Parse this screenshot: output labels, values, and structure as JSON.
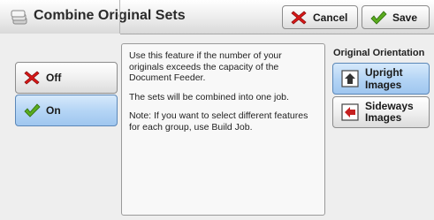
{
  "header": {
    "title": "Combine Original Sets",
    "cancel_label": "Cancel",
    "save_label": "Save",
    "title_icon": "stacked-pages-icon",
    "cancel_icon": "red-x-icon",
    "save_icon": "green-check-icon"
  },
  "options": {
    "off_label": "Off",
    "on_label": "On",
    "selected": "On"
  },
  "message": {
    "line1": "Use this feature if the number of your originals exceeds the capacity of the Document Feeder.",
    "line2": "The sets will be combined into one job.",
    "line3": "Note: If you want to select different features for each group, use Build Job."
  },
  "orientation": {
    "label": "Original Orientation",
    "upright_label": "Upright Images",
    "sideways_label": "Sideways Images",
    "selected": "Upright Images"
  },
  "colors": {
    "selected_blue": "#b5d5f5",
    "cancel_red": "#d81818",
    "save_green": "#5aab1e"
  }
}
